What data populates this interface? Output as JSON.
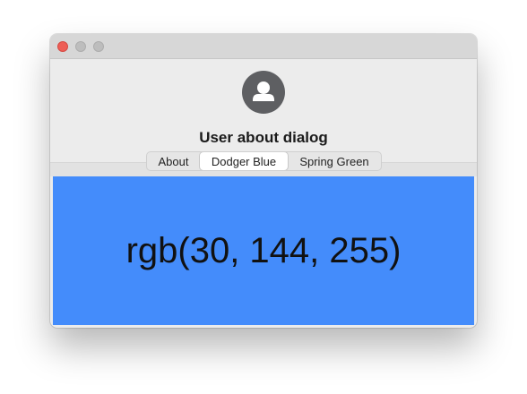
{
  "window": {
    "title_bar_buttons": [
      "close",
      "minimize",
      "zoom"
    ]
  },
  "dialog": {
    "avatar_icon": "user-avatar-icon",
    "title": "User about dialog"
  },
  "tabs": [
    {
      "label": "About",
      "selected": false
    },
    {
      "label": "Dodger Blue",
      "selected": true
    },
    {
      "label": "Spring Green",
      "selected": false
    }
  ],
  "panel": {
    "text": "rgb(30, 144, 255)",
    "background_color": "#448cfb"
  },
  "colors": {
    "close_button": "#ee5e56",
    "inactive_button": "#bdbdbd",
    "avatar_bg": "#5e5f62"
  }
}
